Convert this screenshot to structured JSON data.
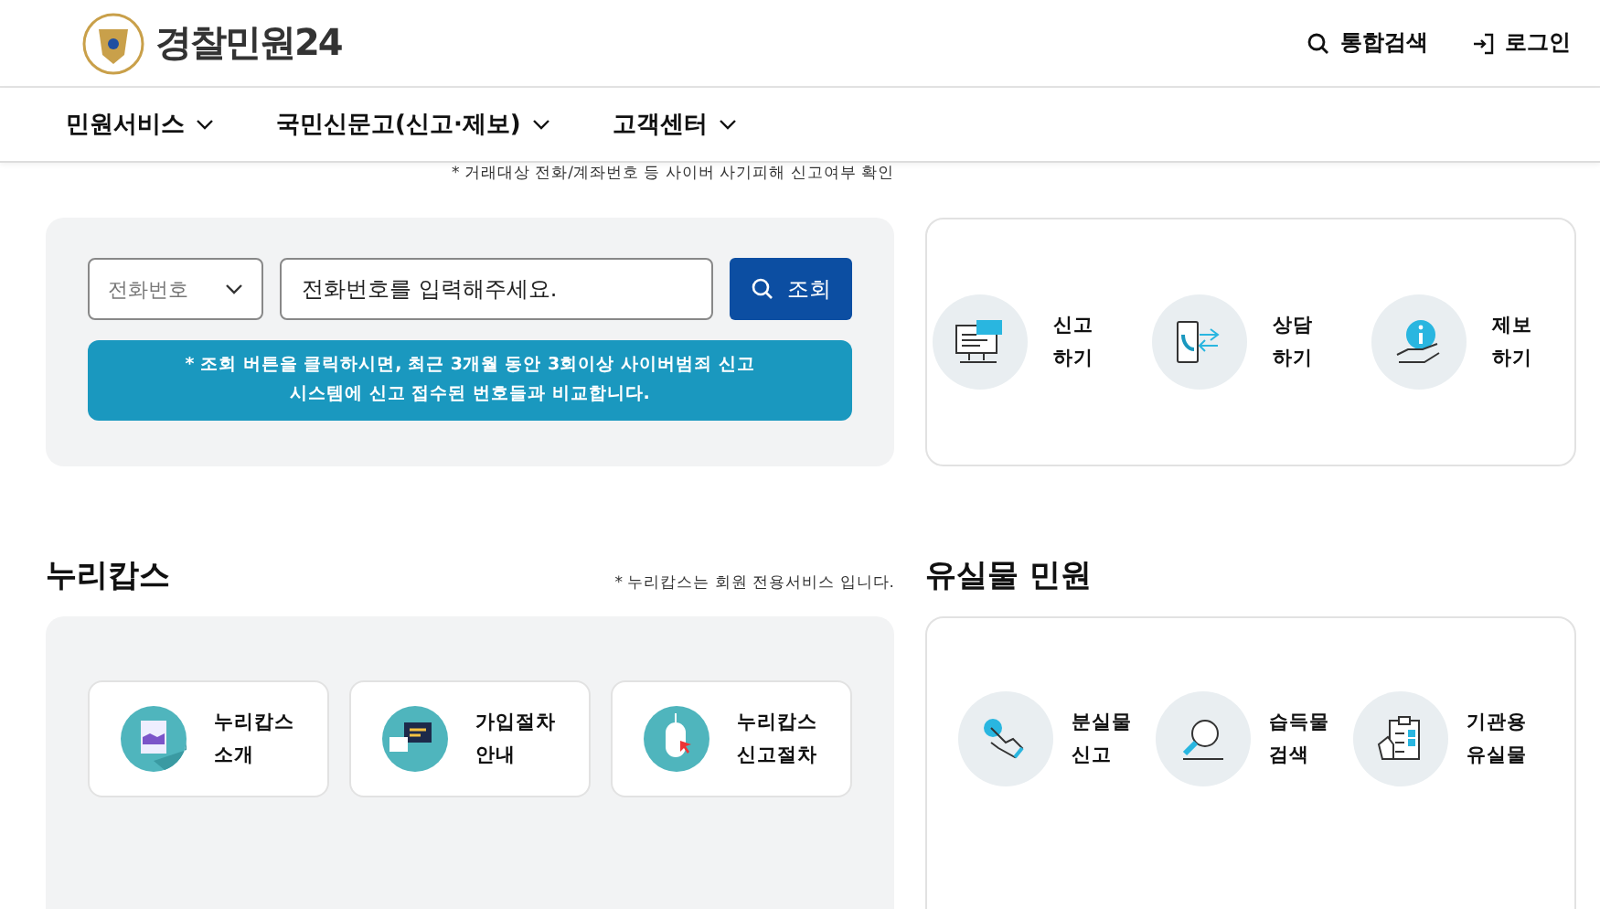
{
  "header": {
    "logo_text": "경찰민원24",
    "actions": [
      {
        "kind": "search",
        "label": "통합검색"
      },
      {
        "kind": "login",
        "label": "로그인"
      }
    ]
  },
  "nav": [
    {
      "label": "민원서비스"
    },
    {
      "label": "국민신문고(신고·제보)"
    },
    {
      "label": "고객센터"
    }
  ],
  "cyber_lookup": {
    "note": "* 거래대상 전화/계좌번호 등 사이버 사기피해 신고여부 확인",
    "select": {
      "value": "전화번호"
    },
    "input": {
      "placeholder": "전화번호를 입력해주세요."
    },
    "button": "조회",
    "notice": [
      "* 조회 버튼을 클릭하시면, 최근 3개월 동안 3회이상 사이버범죄 신고",
      "시스템에 신고 접수된 번호들과 비교합니다."
    ]
  },
  "cyber_report": {
    "items": [
      {
        "kind": "report",
        "lines": [
          "신고",
          "하기"
        ]
      },
      {
        "kind": "consult",
        "lines": [
          "상담",
          "하기"
        ]
      },
      {
        "kind": "tip",
        "lines": [
          "제보",
          "하기"
        ]
      }
    ]
  },
  "nuricops": {
    "title": "누리캅스",
    "note": "* 누리캅스는 회원 전용서비스 입니다.",
    "items": [
      {
        "kind": "document",
        "lines": [
          "누리캅스",
          "소개"
        ]
      },
      {
        "kind": "chat",
        "lines": [
          "가입절차",
          "안내"
        ]
      },
      {
        "kind": "mouse",
        "lines": [
          "누리캅스",
          "신고절차"
        ]
      }
    ]
  },
  "lost_items": {
    "title": "유실물 민원",
    "items": [
      {
        "kind": "hand",
        "lines": [
          "분실물",
          "신고"
        ]
      },
      {
        "kind": "magnifier",
        "lines": [
          "습득물",
          "검색"
        ]
      },
      {
        "kind": "clipboard",
        "lines": [
          "기관용",
          "유실물"
        ]
      }
    ]
  }
}
